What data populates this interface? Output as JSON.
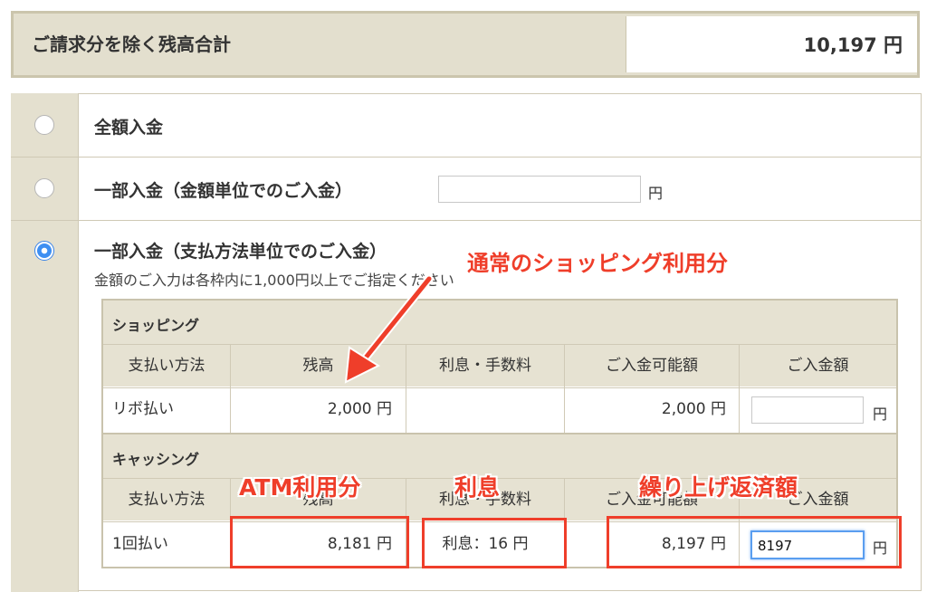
{
  "summary": {
    "label": "ご請求分を除く残高合計",
    "value": "10,197 円"
  },
  "options": [
    {
      "label": "全額入金",
      "selected": false
    },
    {
      "label": "一部入金（金額単位でのご入金）",
      "selected": false,
      "unit": "円",
      "value": ""
    },
    {
      "label": "一部入金（支払方法単位でのご入金）",
      "selected": true,
      "note": "金額のご入力は各枠内に1,000円以上でご指定ください"
    }
  ],
  "columns": [
    "支払い方法",
    "残高",
    "利息・手数料",
    "ご入金可能額",
    "ご入金額"
  ],
  "shopping": {
    "title": "ショッピング",
    "row": {
      "method": "リボ払い",
      "balance": "2,000 円",
      "interest": "",
      "available": "2,000 円",
      "input": "",
      "unit": "円"
    }
  },
  "cashing": {
    "title": "キャッシング",
    "row": {
      "method": "1回払い",
      "balance": "8,181 円",
      "interest": "利息：16 円",
      "available": "8,197 円",
      "input": "8197",
      "unit": "円"
    }
  },
  "annotations": {
    "shopping_usage": "通常のショッピング利用分",
    "atm_usage": "ATM利用分",
    "interest": "利息",
    "prepayment": "繰り上げ返済額"
  },
  "colors": {
    "accent_red": "#ef3e2a",
    "radio_blue": "#3e8ff2",
    "beige": "#e4e0cf"
  }
}
